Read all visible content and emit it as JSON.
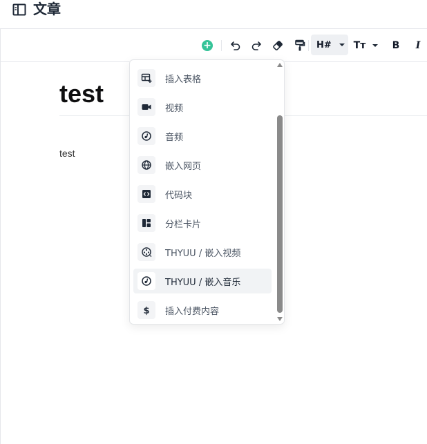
{
  "header": {
    "title": "文章"
  },
  "toolbar": {
    "heading_label": "H#",
    "fontsize_label": "Tт",
    "bold_label": "B",
    "italic_label": "I",
    "plus_glyph": "+"
  },
  "document": {
    "title": "test",
    "body": "test"
  },
  "insert_menu": {
    "items": [
      {
        "label": "插入表格",
        "icon": "table-plus-icon"
      },
      {
        "label": "视频",
        "icon": "video-camera-icon"
      },
      {
        "label": "音频",
        "icon": "audio-disc-icon"
      },
      {
        "label": "嵌入网页",
        "icon": "globe-icon"
      },
      {
        "label": "代码块",
        "icon": "code-block-icon"
      },
      {
        "label": "分栏卡片",
        "icon": "columns-card-icon"
      },
      {
        "label": "THYUU / 嵌入视频",
        "icon": "film-reel-icon"
      },
      {
        "label": "THYUU / 嵌入音乐",
        "icon": "music-disc-icon",
        "hovered": true
      },
      {
        "label": "插入付费内容",
        "icon": "dollar-icon"
      }
    ]
  },
  "colors": {
    "accent": "#35c398",
    "hover_bg": "#f1f3f5",
    "scrollbar": "#8a8a8a"
  }
}
